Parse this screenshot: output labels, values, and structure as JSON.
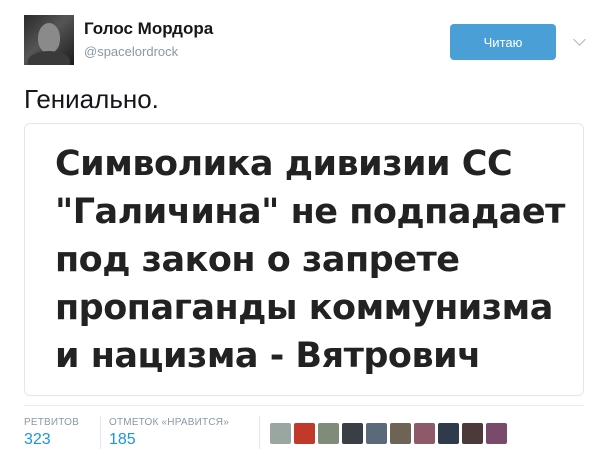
{
  "account": {
    "display_name": "Голос Мордора",
    "handle": "@spacelordrock"
  },
  "follow_button": {
    "label": "Читаю",
    "color": "#4a9fd6"
  },
  "tweet": {
    "text": "Гениально.",
    "image_headline_lines": [
      "Символика дивизии СС",
      "\"Галичина\" не подпадает",
      "под закон о запрете",
      "пропаганды коммунизма",
      "и нацизма - Вятрович"
    ]
  },
  "stats": {
    "retweets_label": "РЕТВИТОВ",
    "retweets_value": "323",
    "likes_label": "ОТМЕТОК «НРАВИТСЯ»",
    "likes_value": "185"
  },
  "liker_avatars": [
    {
      "color": "#9aa7a0"
    },
    {
      "color": "#c0392b"
    },
    {
      "color": "#7f8c7a"
    },
    {
      "color": "#3a3f46"
    },
    {
      "color": "#5b6a7a"
    },
    {
      "color": "#6e6455"
    },
    {
      "color": "#8e5a6a"
    },
    {
      "color": "#2f3a4a"
    },
    {
      "color": "#4c3a3a"
    },
    {
      "color": "#7a4a6a"
    }
  ]
}
